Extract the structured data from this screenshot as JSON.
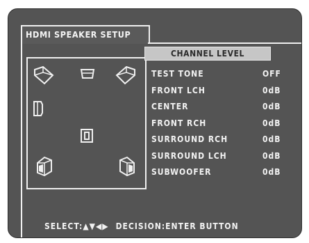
{
  "title": "HDMI SPEAKER SETUP",
  "channel_level": {
    "header": "CHANNEL LEVEL",
    "rows": [
      {
        "label": "TEST TONE",
        "value": "OFF"
      },
      {
        "label": "FRONT LCH",
        "value": "0dB"
      },
      {
        "label": "CENTER",
        "value": "0dB"
      },
      {
        "label": "FRONT RCH",
        "value": "0dB"
      },
      {
        "label": "SURROUND RCH",
        "value": "0dB"
      },
      {
        "label": "SURROUND LCH",
        "value": "0dB"
      },
      {
        "label": "SUBWOOFER",
        "value": "0dB"
      }
    ]
  },
  "footer": {
    "select_label": "SELECT:",
    "select_arrows": "▲▼◀▶",
    "decision": "DECISION:ENTER BUTTON"
  },
  "speakers": [
    "front-left-speaker-icon",
    "center-speaker-icon",
    "front-right-speaker-icon",
    "side-speaker-icon",
    "subwoofer-icon",
    "surround-left-speaker-icon",
    "surround-right-speaker-icon"
  ],
  "colors": {
    "background": "#545454",
    "text": "#f2f2f2",
    "header_bg": "#c6c6c6",
    "header_text": "#2a2a2a"
  }
}
